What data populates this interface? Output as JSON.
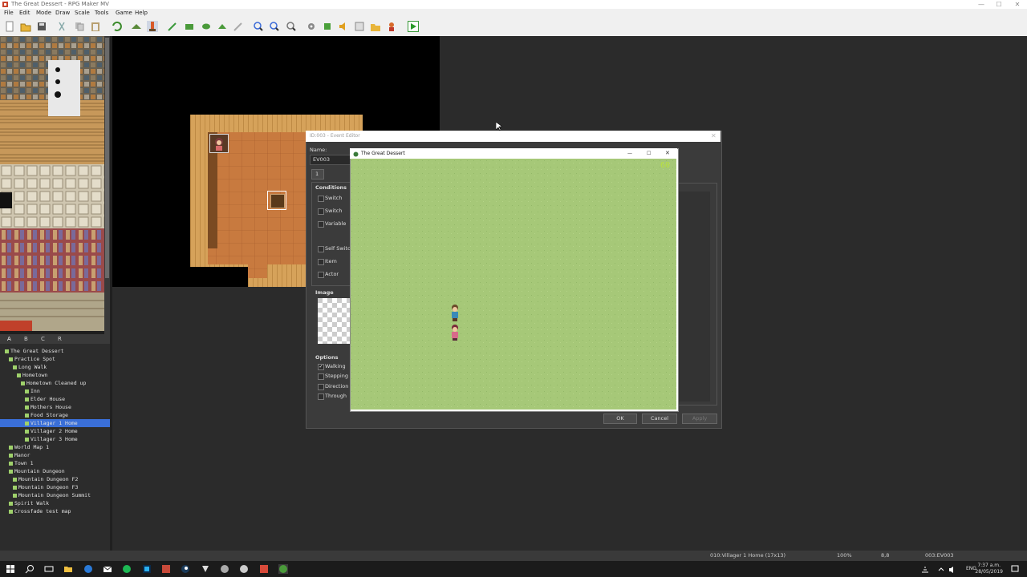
{
  "window": {
    "title": "The Great Dessert - RPG Maker MV",
    "controls": [
      "—",
      "☐",
      "✕"
    ]
  },
  "menu": [
    "File",
    "Edit",
    "Mode",
    "Draw",
    "Scale",
    "Tools",
    "Game",
    "Help"
  ],
  "tile_tabs": [
    "A",
    "B",
    "C",
    "R"
  ],
  "map_tree": [
    {
      "label": "The Great Dessert",
      "indent": 0
    },
    {
      "label": "Practice Spot",
      "indent": 1
    },
    {
      "label": "Long Walk",
      "indent": 2
    },
    {
      "label": "Hometown",
      "indent": 3
    },
    {
      "label": "Hometown Cleaned up",
      "indent": 4
    },
    {
      "label": "Inn",
      "indent": 5
    },
    {
      "label": "Elder House",
      "indent": 5
    },
    {
      "label": "Mothers House",
      "indent": 5
    },
    {
      "label": "Food Storage",
      "indent": 5
    },
    {
      "label": "Villager 1 Home",
      "indent": 5,
      "selected": true
    },
    {
      "label": "Villager 2 Home",
      "indent": 5
    },
    {
      "label": "Villager 3 Home",
      "indent": 5
    },
    {
      "label": "World Map 1",
      "indent": 1
    },
    {
      "label": "Manor",
      "indent": 1
    },
    {
      "label": "Town 1",
      "indent": 1
    },
    {
      "label": "Mountain Dungeon",
      "indent": 1
    },
    {
      "label": "Mountain Dungeon F2",
      "indent": 2
    },
    {
      "label": "Mountain Dungeon F3",
      "indent": 2
    },
    {
      "label": "Mountain Dungeon Summit",
      "indent": 2
    },
    {
      "label": "Spirit Walk",
      "indent": 1
    },
    {
      "label": "Crossfade test map",
      "indent": 1
    }
  ],
  "event_editor": {
    "title": "ID:003 - Event Editor",
    "name_label": "Name:",
    "name_value": "EV003",
    "page_tab": "1",
    "conditions_label": "Conditions",
    "conditions": [
      "Switch",
      "Switch",
      "Variable",
      "Self Switch",
      "Item",
      "Actor"
    ],
    "image_label": "Image",
    "options_label": "Options",
    "options": [
      {
        "label": "Walking",
        "checked": true
      },
      {
        "label": "Stepping",
        "checked": false
      },
      {
        "label": "Direction",
        "checked": false
      },
      {
        "label": "Through",
        "checked": false
      }
    ],
    "buttons": {
      "ok": "OK",
      "cancel": "Cancel",
      "apply": "Apply"
    }
  },
  "game_window": {
    "title": "The Great Dessert",
    "fps": "60",
    "controls": [
      "—",
      "☐",
      "✕"
    ]
  },
  "status_bar": {
    "map": "010:Villager 1 Home (17x13)",
    "zoom": "100%",
    "coords": "8,8",
    "event": "003:EV003"
  },
  "taskbar": {
    "time": "7:37 a.m.",
    "date": "28/05/2019",
    "lang": "ENG"
  }
}
